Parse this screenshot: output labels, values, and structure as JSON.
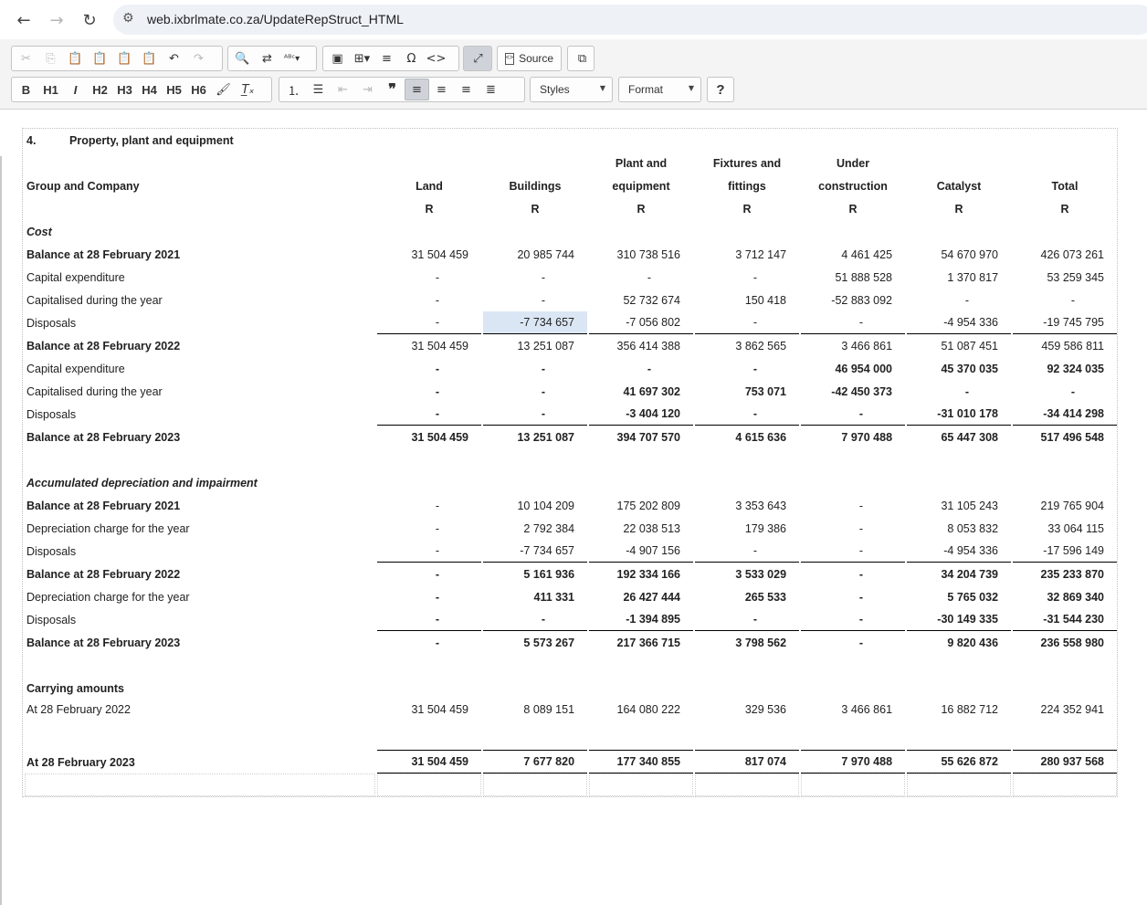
{
  "browser": {
    "url": "web.ixbrlmate.co.za/UpdateRepStruct_HTML",
    "back_icon": "←",
    "forward_icon": "→",
    "reload_icon": "↻",
    "site_info_icon": "⚙"
  },
  "toolbar": {
    "source_label": "Source",
    "styles_label": "Styles",
    "format_label": "Format",
    "help_label": "?",
    "h1": "H1",
    "h2": "H2",
    "h3": "H3",
    "h4": "H4",
    "h5": "H5",
    "h6": "H6",
    "bold": "B",
    "italic": "I"
  },
  "table": {
    "note_number": "4.",
    "note_title": "Property, plant and equipment",
    "group_label": "Group and Company",
    "columns": [
      "Land",
      "Buildings",
      "Plant and equipment",
      "Fixtures and fittings",
      "Under construction",
      "Catalyst",
      "Total"
    ],
    "col_hdr": {
      "plant_line1": "Plant and",
      "plant_line2": "equipment",
      "fix_line1": "Fixtures and",
      "fix_line2": "fittings",
      "under_line1": "Under",
      "under_line2": "construction"
    },
    "currency": "R",
    "sections": {
      "cost": "Cost",
      "accum": "Accumulated depreciation and impairment",
      "carrying": "Carrying amounts"
    },
    "rows": {
      "cost_bal_2021": {
        "label": "Balance at 28 February 2021",
        "v": [
          "31 504 459",
          "20 985 744",
          "310 738 516",
          "3 712 147",
          "4 461 425",
          "54 670 970",
          "426 073 261"
        ]
      },
      "cost_capex_2022": {
        "label": "Capital expenditure",
        "v": [
          "-",
          "-",
          "-",
          "-",
          "51 888 528",
          "1 370 817",
          "53 259 345"
        ]
      },
      "cost_capitalised_2022": {
        "label": "Capitalised during the year",
        "v": [
          "-",
          "-",
          "52 732 674",
          "150 418",
          "-52 883 092",
          "-",
          "-"
        ]
      },
      "cost_disposals_2022": {
        "label": "Disposals",
        "v": [
          "-",
          "-7 734 657",
          "-7 056 802",
          "-",
          "-",
          "-4 954 336",
          "-19 745 795"
        ]
      },
      "cost_bal_2022": {
        "label": "Balance at 28 February 2022",
        "v": [
          "31 504 459",
          "13 251 087",
          "356 414 388",
          "3 862 565",
          "3 466 861",
          "51 087 451",
          "459 586 811"
        ]
      },
      "cost_capex_2023": {
        "label": "Capital expenditure",
        "v": [
          "-",
          "-",
          "-",
          "-",
          "46 954 000",
          "45 370 035",
          "92 324 035"
        ]
      },
      "cost_capitalised_2023": {
        "label": "Capitalised during the year",
        "v": [
          "-",
          "-",
          "41 697 302",
          "753 071",
          "-42 450 373",
          "-",
          "-"
        ]
      },
      "cost_disposals_2023": {
        "label": "Disposals",
        "v": [
          "-",
          "-",
          "-3 404 120",
          "-",
          "-",
          "-31 010 178",
          "-34 414 298"
        ]
      },
      "cost_bal_2023": {
        "label": "Balance at 28 February 2023",
        "v": [
          "31 504 459",
          "13 251 087",
          "394 707 570",
          "4 615 636",
          "7 970 488",
          "65 447 308",
          "517 496 548"
        ]
      },
      "acc_bal_2021": {
        "label": "Balance at 28 February 2021",
        "v": [
          "-",
          "10 104 209",
          "175 202 809",
          "3 353 643",
          "-",
          "31 105 243",
          "219 765 904"
        ]
      },
      "acc_dep_2022": {
        "label": "Depreciation charge for the year",
        "v": [
          "-",
          "2 792 384",
          "22 038 513",
          "179 386",
          "-",
          "8 053 832",
          "33 064 115"
        ]
      },
      "acc_disp_2022": {
        "label": "Disposals",
        "v": [
          "-",
          "-7 734 657",
          "-4 907 156",
          "-",
          "-",
          "-4 954 336",
          "-17 596 149"
        ]
      },
      "acc_bal_2022": {
        "label": "Balance at 28 February 2022",
        "v": [
          "-",
          "5 161 936",
          "192 334 166",
          "3 533 029",
          "-",
          "34 204 739",
          "235 233 870"
        ]
      },
      "acc_dep_2023": {
        "label": "Depreciation charge for the year",
        "v": [
          "-",
          "411 331",
          "26 427 444",
          "265 533",
          "-",
          "5 765 032",
          "32 869 340"
        ]
      },
      "acc_disp_2023": {
        "label": "Disposals",
        "v": [
          "-",
          "-",
          "-1 394 895",
          "-",
          "-",
          "-30 149 335",
          "-31 544 230"
        ]
      },
      "acc_bal_2023": {
        "label": "Balance at 28 February 2023",
        "v": [
          "-",
          "5 573 267",
          "217 366 715",
          "3 798 562",
          "-",
          "9 820 436",
          "236 558 980"
        ]
      },
      "carry_2022": {
        "label": "At 28 February 2022",
        "v": [
          "31 504 459",
          "8 089 151",
          "164 080 222",
          "329 536",
          "3 466 861",
          "16 882 712",
          "224 352 941"
        ]
      },
      "carry_2023": {
        "label": "At 28 February 2023",
        "v": [
          "31 504 459",
          "7 677 820",
          "177 340 855",
          "817 074",
          "7 970 488",
          "55 626 872",
          "280 937 568"
        ]
      }
    }
  }
}
